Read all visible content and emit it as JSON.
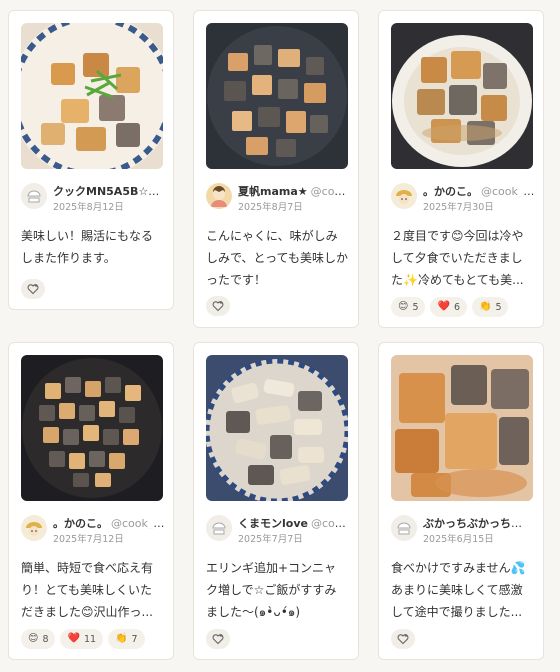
{
  "cards": [
    {
      "user": "クックMN5A5B☆",
      "handle": "@...",
      "date": "2025年8月12日",
      "comment": "美味しい！賜活にもなるしまた作ります。",
      "reactions": []
    },
    {
      "user": "夏帆mama★",
      "handle": "@coo...",
      "date": "2025年8月7日",
      "comment": "こんにゃくに、味がしみしみで、とっても美味しかったです！",
      "reactions": []
    },
    {
      "user": "。かのこ。",
      "handle": "@cook_4...",
      "date": "2025年7月30日",
      "comment": "２度目です😊今回は冷やして夕食でいただきました✨冷めてもとても美...",
      "reactions": [
        {
          "emoji": "😊",
          "count": "5"
        },
        {
          "emoji": "❤️",
          "count": "6"
        },
        {
          "emoji": "👏",
          "count": "5"
        }
      ]
    },
    {
      "user": "。かのこ。",
      "handle": "@cook_4...",
      "date": "2025年7月12日",
      "comment": "簡単、時短で食べ応え有り！とても美味しくいただきました😊沢山作っ...",
      "reactions": [
        {
          "emoji": "😊",
          "count": "8"
        },
        {
          "emoji": "❤️",
          "count": "11"
        },
        {
          "emoji": "👏",
          "count": "7"
        }
      ]
    },
    {
      "user": "くまモンlove",
      "handle": "@coo...",
      "date": "2025年7月7日",
      "comment": "エリンギ追加+コンニャク増しで☆ご飯がすすみました〜(๑•̀ᴗ•́๑)",
      "reactions": []
    },
    {
      "user": "ぶかっちぶかっち",
      "handle": "@co...",
      "date": "2025年6月15日",
      "comment": "食べかけですみません💦あまりに美味しくて感激して途中で撮りました...",
      "reactions": []
    }
  ],
  "icons": {
    "add_reaction": "heart-plus-icon"
  }
}
